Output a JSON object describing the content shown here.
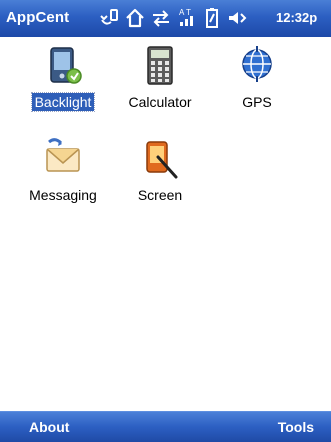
{
  "title_bar": {
    "app_title": "AppCent",
    "time": "12:32p",
    "status_icons": [
      "connectivity-icon",
      "home-icon",
      "sync-icon",
      "signal-icon",
      "battery-icon",
      "volume-icon"
    ]
  },
  "apps": [
    {
      "label": "Backlight",
      "icon": "backlight-icon",
      "selected": true
    },
    {
      "label": "Calculator",
      "icon": "calculator-icon",
      "selected": false
    },
    {
      "label": "GPS",
      "icon": "gps-globe-icon",
      "selected": false
    },
    {
      "label": "Messaging",
      "icon": "messaging-envelope-icon",
      "selected": false
    },
    {
      "label": "Screen",
      "icon": "screen-stylus-icon",
      "selected": false
    }
  ],
  "softkeys": {
    "left": "About",
    "right": "Tools"
  },
  "colors": {
    "bar_blue": "#2c5fc2",
    "selection_blue": "#2e5eb8"
  }
}
